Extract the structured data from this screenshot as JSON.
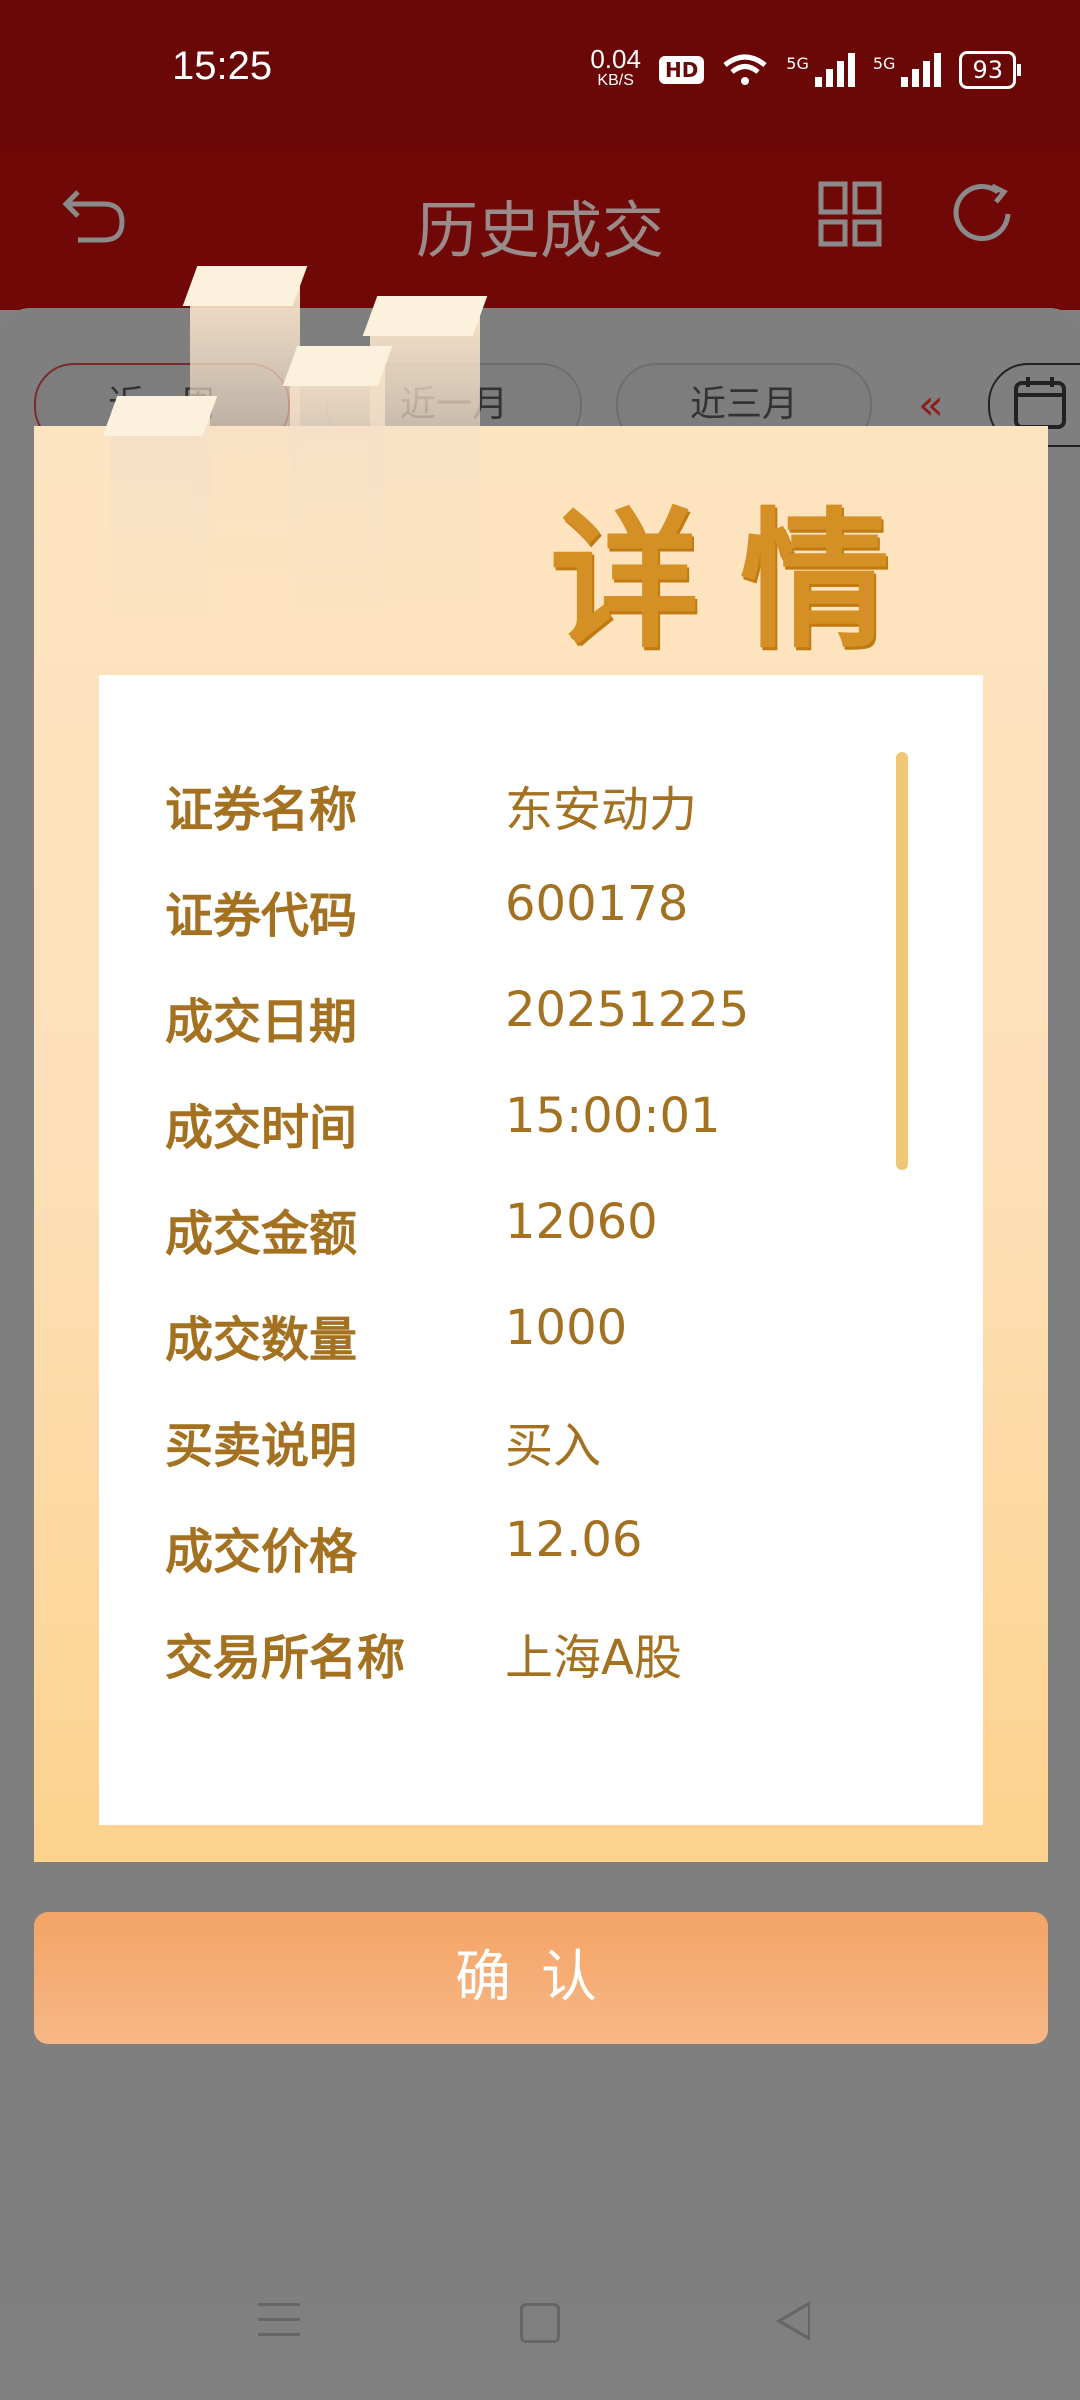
{
  "status_bar": {
    "time": "15:25",
    "net_speed": "0.04",
    "net_unit": "KB/S",
    "hd_badge": "HD",
    "signal1_label": "5G",
    "signal2_label": "5G",
    "battery": "93"
  },
  "header": {
    "title": "历史成交",
    "icons": [
      "back-icon",
      "grid-icon",
      "refresh-icon"
    ]
  },
  "filters": {
    "items": [
      "近一周",
      "近一月",
      "近三月"
    ],
    "active_index": 0,
    "icons": [
      "chevron-left-icon",
      "calendar-icon"
    ]
  },
  "modal": {
    "title": "详情",
    "rows": [
      {
        "label": "证券名称",
        "value": "东安动力"
      },
      {
        "label": "证券代码",
        "value": "600178"
      },
      {
        "label": "成交日期",
        "value": "20251225"
      },
      {
        "label": "成交时间",
        "value": "15:00:01"
      },
      {
        "label": "成交金额",
        "value": "12060"
      },
      {
        "label": "成交数量",
        "value": "1000"
      },
      {
        "label": "买卖说明",
        "value": "买入"
      },
      {
        "label": "成交价格",
        "value": "12.06"
      },
      {
        "label": "交易所名称",
        "value": "上海A股"
      }
    ],
    "confirm_label": "确认"
  },
  "colors": {
    "header_bg": "#700808",
    "modal_title": "#d48f25",
    "text_gold": "#a37120",
    "confirm_bg": "#f4a466"
  }
}
